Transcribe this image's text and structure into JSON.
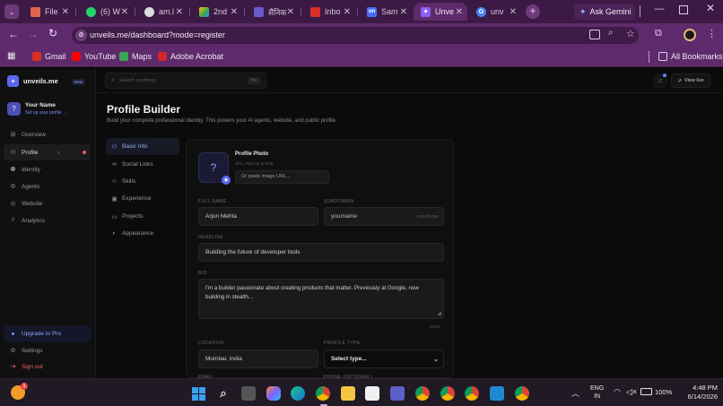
{
  "browser": {
    "tabs": [
      {
        "label": "File",
        "color": "#e0654f",
        "glyph": "F"
      },
      {
        "label": "(6) W",
        "color": "#25d366",
        "glyph": "W"
      },
      {
        "label": "am.l",
        "color": "#555555",
        "glyph": "a"
      },
      {
        "label": "2nd",
        "color": "#34a853",
        "glyph": "▲"
      },
      {
        "label": "सैनिक",
        "color": "#6a5acd",
        "glyph": "स"
      },
      {
        "label": "Inbo",
        "color": "#d93025",
        "glyph": "M"
      },
      {
        "label": "Sam",
        "color": "#4a6cf7",
        "glyph": "un"
      },
      {
        "label": "Unve",
        "color": "#8b5cf6",
        "glyph": "✦"
      },
      {
        "label": "unv",
        "color": "#4285f4",
        "glyph": "G"
      }
    ],
    "ask_gemini": "Ask Gemini",
    "url": "unveils.me/dashboard?mode=register",
    "bookmarks": [
      {
        "label": "Gmail",
        "color": "#d93025"
      },
      {
        "label": "YouTube",
        "color": "#ff0000"
      },
      {
        "label": "Maps",
        "color": "#34a853"
      },
      {
        "label": "Adobe Acrobat",
        "color": "#d4252b"
      }
    ],
    "all_bookmarks": "All Bookmarks"
  },
  "app": {
    "brand": "unveils.me",
    "badge": "Beta",
    "user": {
      "name": "Your Name",
      "link": "Set up your profile →",
      "avatar": "?"
    },
    "nav": [
      {
        "label": "Overview",
        "icon": "grid-icon"
      },
      {
        "label": "Profile",
        "icon": "user-icon"
      },
      {
        "label": "Identity",
        "icon": "identity-icon"
      },
      {
        "label": "Agents",
        "icon": "agents-icon"
      },
      {
        "label": "Website",
        "icon": "globe-icon"
      },
      {
        "label": "Analytics",
        "icon": "chart-icon"
      }
    ],
    "upgrade": "Upgrade to Pro",
    "settings": "Settings",
    "signout": "Sign out",
    "search_placeholder": "Search anything...",
    "search_shortcut": "⌘K",
    "view_live": "View live",
    "colors": {
      "accent": "#6c7dff",
      "danger": "#f05a5a"
    }
  },
  "page": {
    "title": "Profile Builder",
    "subtitle": "Build your complete professional identity. This powers your AI agents, website, and public profile.",
    "sections": [
      "Basic Info",
      "Social Links",
      "Skills",
      "Experience",
      "Projects",
      "Appearance"
    ],
    "photo": {
      "title": "Profile Photo",
      "hint": "JPG, PNG up to 5MB",
      "url_placeholder": "Or paste image URL..."
    },
    "fields": {
      "full_name": {
        "label": "FULL NAME",
        "value": "Arjun Mehta"
      },
      "subdomain": {
        "label": "SUBDOMAIN",
        "placeholder": "yourname",
        "suffix": ".unveils.me"
      },
      "headline": {
        "label": "HEADLINE",
        "value": "Building the future of developer tools"
      },
      "bio": {
        "label": "BIO",
        "value": "I'm a builder passionate about creating products that matter. Previously at Google, now building in stealth...",
        "counter": "0/500"
      },
      "location": {
        "label": "LOCATION",
        "value": "Mumbai, India"
      },
      "profile_type": {
        "label": "PROFILE TYPE",
        "value": "Select type..."
      },
      "email": {
        "label": "EMAIL"
      },
      "phone": {
        "label": "PHONE (OPTIONAL)"
      }
    }
  },
  "taskbar": {
    "lang1": "ENG",
    "lang2": "IN",
    "battery": "100%",
    "time": "4:48 PM",
    "date": "6/14/2026"
  }
}
